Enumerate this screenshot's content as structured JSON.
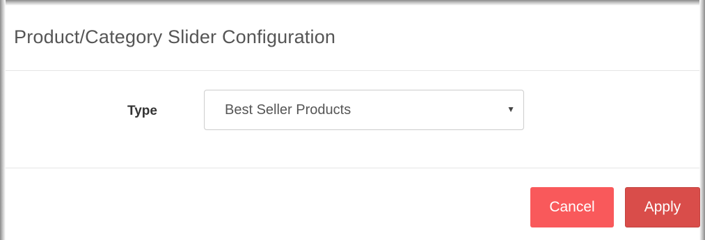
{
  "modal": {
    "title": "Product/Category Slider Configuration"
  },
  "form": {
    "type_label": "Type",
    "type_select": {
      "selected": "Best Seller Products"
    }
  },
  "footer": {
    "cancel_label": "Cancel",
    "apply_label": "Apply"
  },
  "colors": {
    "cancel_button": "#f9595b",
    "apply_button": "#d94d4a",
    "title_text": "#555555"
  },
  "icons": {
    "select_arrow": "caret-down-icon"
  }
}
